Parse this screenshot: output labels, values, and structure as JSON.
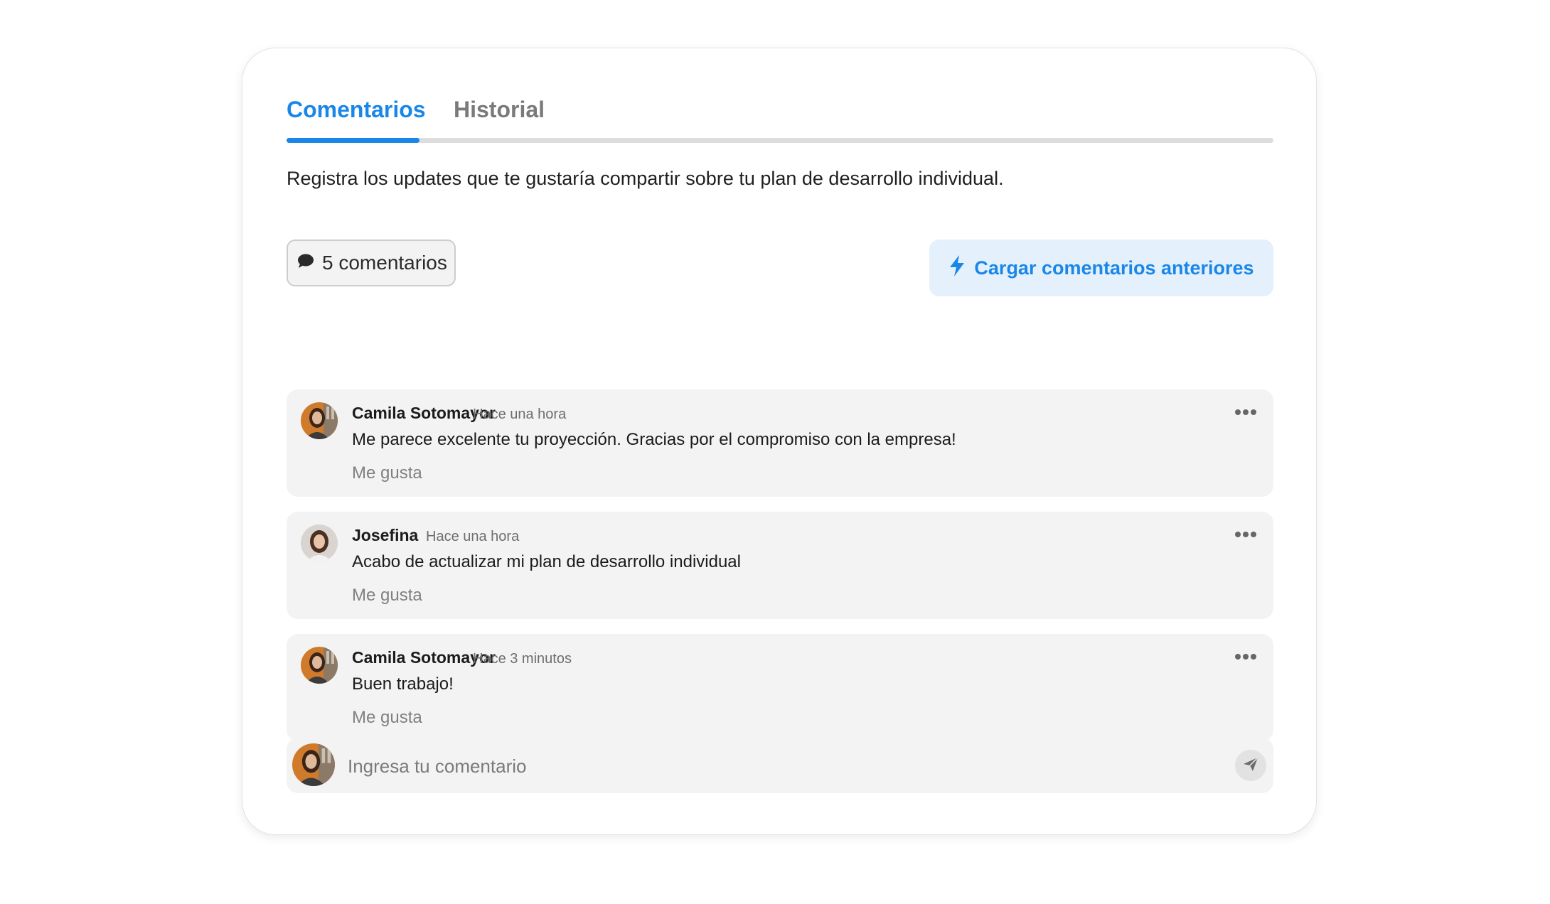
{
  "tabs": [
    {
      "label": "Comentarios",
      "active": true
    },
    {
      "label": "Historial",
      "active": false
    }
  ],
  "description": "Registra los updates que te gustaría compartir sobre tu plan de desarrollo individual.",
  "comment_count_label": "5 comentarios",
  "load_more_label": "Cargar comentarios anteriores",
  "comments": [
    {
      "author": "Camila Sotomayor",
      "time": "Hace una hora",
      "text": "Me parece excelente tu proyección. Gracias por el compromiso con la empresa!",
      "like_label": "Me gusta"
    },
    {
      "author": "Josefina",
      "time": "Hace una hora",
      "text": "Acabo de actualizar mi plan de desarrollo individual",
      "like_label": "Me gusta"
    },
    {
      "author": "Camila Sotomayor",
      "time": "Hace 3 minutos",
      "text": "Buen trabajo!",
      "like_label": "Me gusta"
    }
  ],
  "compose": {
    "placeholder": "Ingresa tu comentario"
  },
  "icons": {
    "comment_count": "speech-bubble-icon",
    "load_more": "lightning-bolt-icon",
    "comment_menu": "more-horizontal-icon",
    "send": "paper-plane-icon"
  },
  "colors": {
    "accent": "#1a87e8",
    "accent_bg": "#e4f0fc",
    "comment_bg": "#f3f3f3"
  }
}
